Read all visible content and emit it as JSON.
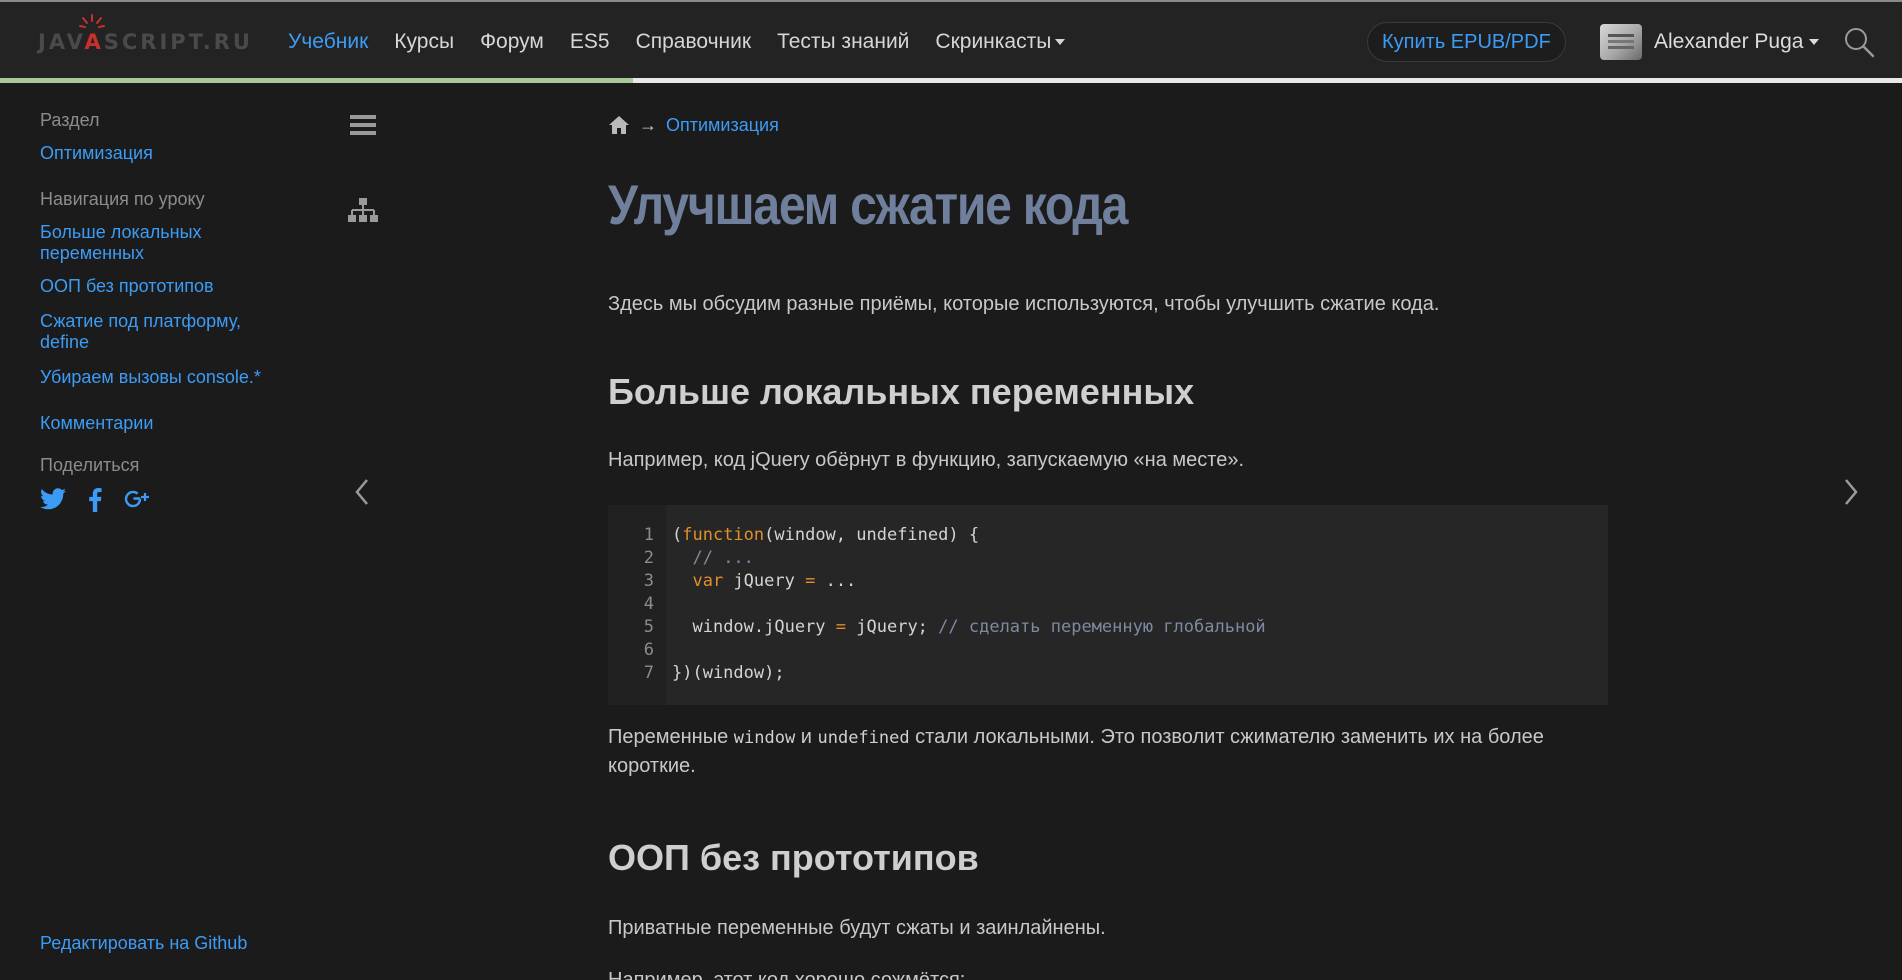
{
  "header": {
    "logo_text_part1": "JAV",
    "logo_text_accent": "A",
    "logo_text_part2": "SCRIPT.RU",
    "nav": [
      {
        "label": "Учебник",
        "active": true
      },
      {
        "label": "Курсы",
        "active": false
      },
      {
        "label": "Форум",
        "active": false
      },
      {
        "label": "ES5",
        "active": false
      },
      {
        "label": "Справочник",
        "active": false
      },
      {
        "label": "Тесты знаний",
        "active": false
      },
      {
        "label": "Скринкасты",
        "active": false
      }
    ],
    "buy_label": "Купить EPUB/PDF",
    "user_name": "Alexander Puga",
    "search_icon": "search-icon"
  },
  "progress": {
    "fraction": 0.333
  },
  "sidebar": {
    "section_heading": "Раздел",
    "section_link": "Оптимизация",
    "nav_heading": "Навигация по уроку",
    "nav_links": [
      "Больше локальных переменных",
      "ООП без прототипов",
      "Сжатие под платформу, define",
      "Убираем вызовы console.*"
    ],
    "comments_link": "Комментарии",
    "share_heading": "Поделиться",
    "share_icons": [
      "twitter-icon",
      "facebook-icon",
      "google-plus-icon"
    ],
    "edit_link": "Редактировать на Github"
  },
  "main": {
    "breadcrumb_arrow": "→",
    "breadcrumb_link": "Оптимизация",
    "title": "Улучшаем сжатие кода",
    "intro": "Здесь мы обсудим разные приёмы, которые используются, чтобы улучшить сжатие кода.",
    "h2_1": "Больше локальных переменных",
    "p_example": "Например, код jQuery обёрнут в функцию, запускаемую «на месте».",
    "code_lines": [
      1,
      2,
      3,
      4,
      5,
      6,
      7
    ],
    "code": {
      "l1_open": "(",
      "l1_kw": "function",
      "l1_rest": "(window, undefined) {",
      "l2_comment": "// ...",
      "l3_kw": "var",
      "l3_ident": " jQuery ",
      "l3_op": "=",
      "l3_rest": " ...",
      "l5_ident": "window.jQuery ",
      "l5_op": "=",
      "l5_rest": " jQuery; ",
      "l5_comment": "// сделать переменную глобальной",
      "l7": "})(window);"
    },
    "p_after_1": "Переменные ",
    "p_after_code1": "window",
    "p_after_2": " и ",
    "p_after_code2": "undefined",
    "p_after_3": " стали локальными. Это позволит сжимателю заменить их на более короткие.",
    "h2_2": "ООП без прототипов",
    "p_private": "Приватные переменные будут сжаты и заинлайнены.",
    "p_cut": "Например, этот код хорошо сожмётся:"
  }
}
